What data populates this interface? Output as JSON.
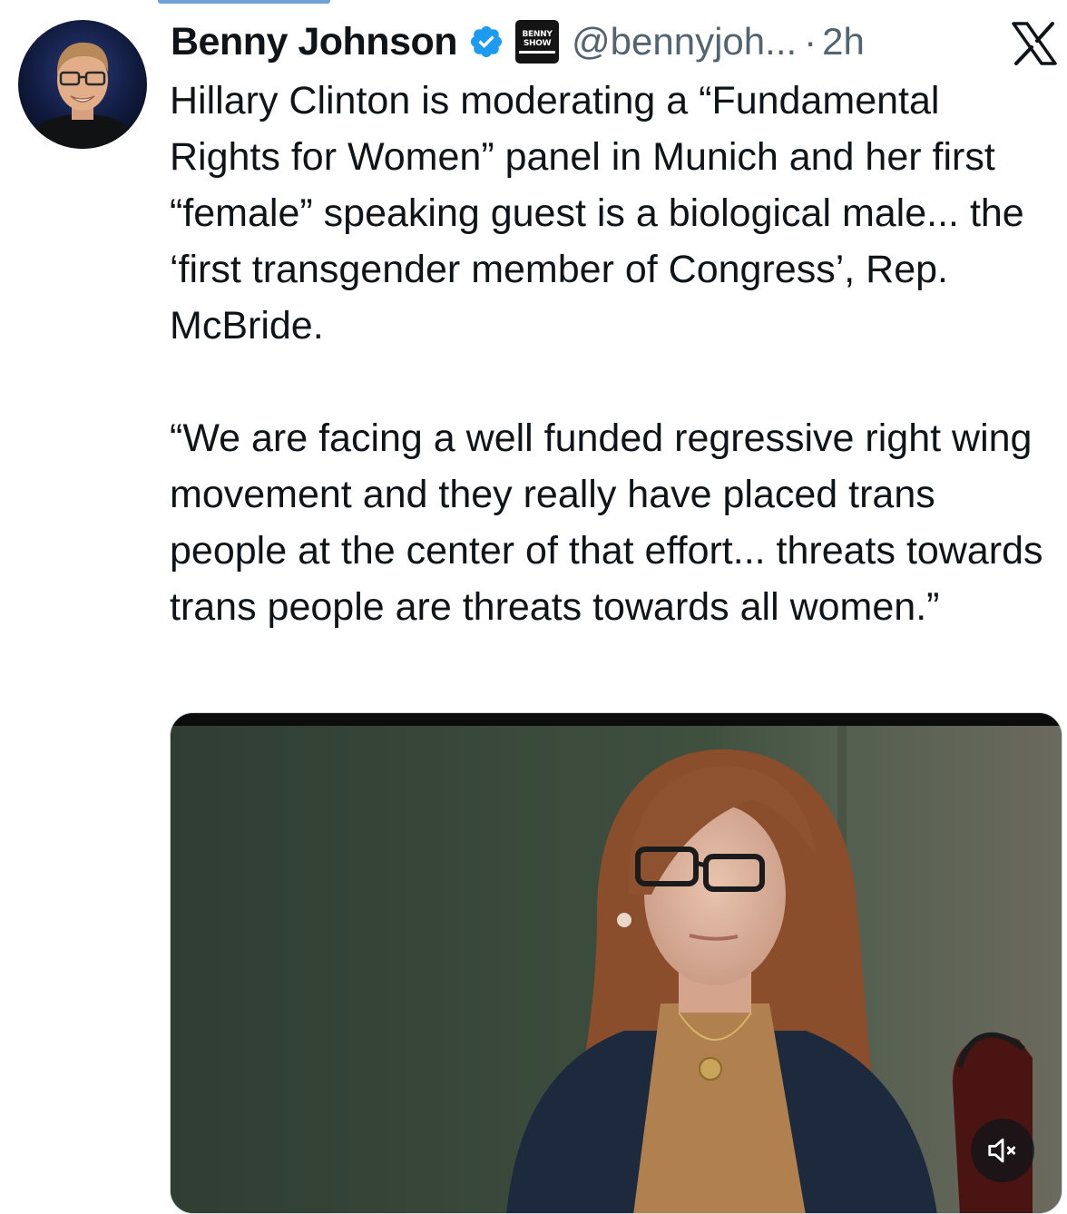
{
  "tweet": {
    "author": {
      "display_name": "Benny Johnson",
      "handle": "@bennyjoh...",
      "verified_color": "#1d9bf0",
      "affiliate_badge": {
        "line1": "BENNY",
        "line2": "SHOW"
      }
    },
    "separator": "·",
    "time": "2h",
    "text": "Hillary Clinton is moderating a “Fundamental Rights for Women” panel in Munich and her first “female” speaking guest is a biological male... the ‘first transgender member of Congress’, Rep. McBride.\n\n“We are facing a well funded regressive right wing movement and they really have placed trans people at the center of that effort... threats towards trans people are threats towards all women.”",
    "media": {
      "type": "video",
      "mute_icon": "volume-muted-icon"
    }
  },
  "icons": {
    "platform": "x-logo-icon",
    "verified": "verified-badge-icon"
  },
  "colors": {
    "text": "#0f1419",
    "secondary": "#536471",
    "accent": "#1d9bf0"
  }
}
